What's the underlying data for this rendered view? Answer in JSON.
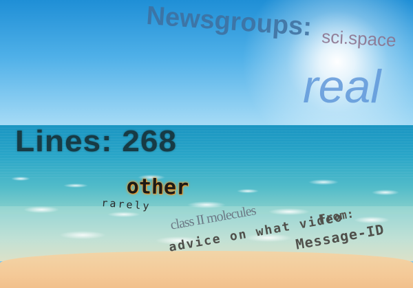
{
  "words": {
    "newsgroups": "Newsgroups:",
    "sci_space": "sci.space",
    "real": "real",
    "lines": "Lines: 268",
    "other": "other",
    "rarely": "rarely",
    "class_molecules": "class II molecules",
    "from": "From:",
    "advice_line": "advice on what video",
    "message_id": "Message-ID"
  },
  "colors": {
    "sky_top": "#1f8fd6",
    "sea": "#1a95c2",
    "sand": "#f4c997",
    "other_glow": "#f09020"
  }
}
